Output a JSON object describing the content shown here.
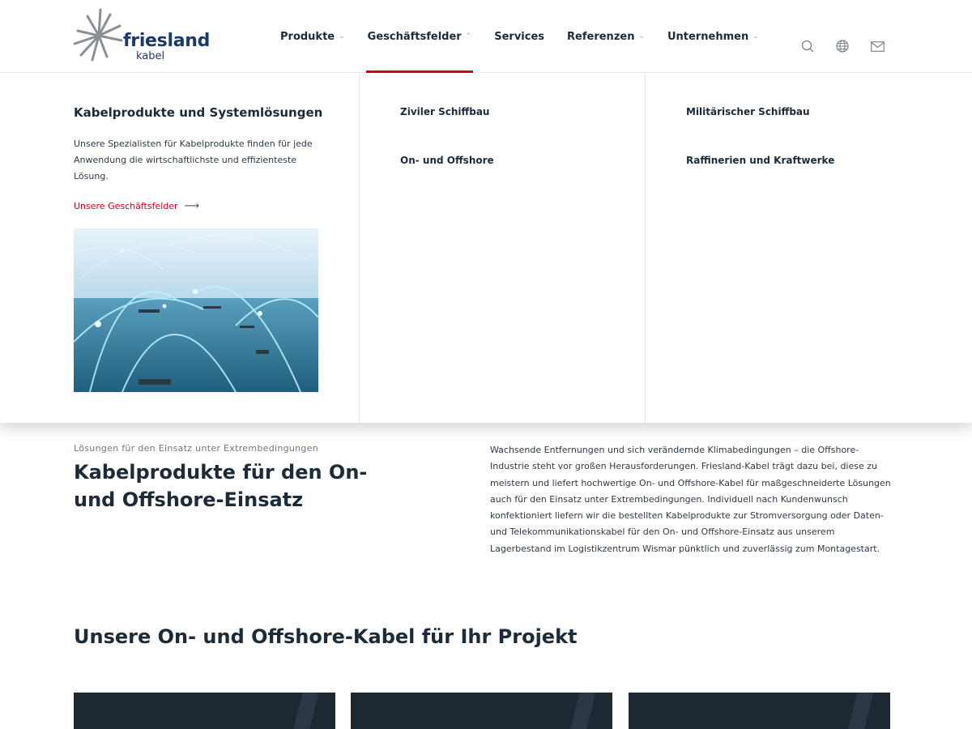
{
  "brand": {
    "name": "friesland",
    "sub": "kabel",
    "colors": {
      "navy": "#1b3a6b",
      "accent": "#d0021b",
      "logo_rays": "#8a8f96"
    }
  },
  "nav": {
    "items": [
      {
        "label": "Produkte",
        "has_dropdown": true
      },
      {
        "label": "Geschäftsfelder",
        "has_dropdown": true,
        "active": true
      },
      {
        "label": "Services",
        "has_dropdown": false
      },
      {
        "label": "Referenzen",
        "has_dropdown": true
      },
      {
        "label": "Unternehmen",
        "has_dropdown": true
      }
    ],
    "chevron_down": "⌄",
    "chevron_up": "⌃"
  },
  "utility_icons": [
    "search-icon",
    "globe-icon",
    "mail-icon"
  ],
  "mega_menu": {
    "title": "Kabelprodukte und Systemlösungen",
    "description": "Unsere Spezialisten für Kabelprodukte finden für jede Anwendung die wirtschaftlichste und effizienteste Lösung.",
    "link_label": "Unsere Geschäftsfelder",
    "link_arrow": "⟶",
    "col2": [
      "Ziviler Schiffbau",
      "On- und Offshore"
    ],
    "col3": [
      "Militärischer Schiffbau",
      "Raffinerien und Kraftwerke"
    ]
  },
  "content": {
    "eyebrow": "Lösungen für den Einsatz unter Extrembedingungen",
    "heading": "Kabelprodukte für den On- und Offshore-Einsatz",
    "body": "Wachsende Entfernungen und sich verändernde Klimabedingungen – die Offshore-Industrie steht vor großen Herausforderungen. Friesland-Kabel trägt dazu bei, diese zu meistern und liefert hochwertige On- und Offshore-Kabel für maßgeschneiderte Lösungen auch für den Einsatz unter Extrembedingungen. Individuell nach Kundenwunsch konfektioniert liefern wir die bestellten Kabelprodukte zur Stromversorgung oder Daten- und Telekommunikationskabel für den On- und Offshore-Einsatz aus unserem Lagerbestand im Logistikzentrum Wismar pünktlich und zuverlässig zum Montagestart.",
    "section_heading": "Unsere On- und Offshore-Kabel für Ihr Projekt"
  }
}
